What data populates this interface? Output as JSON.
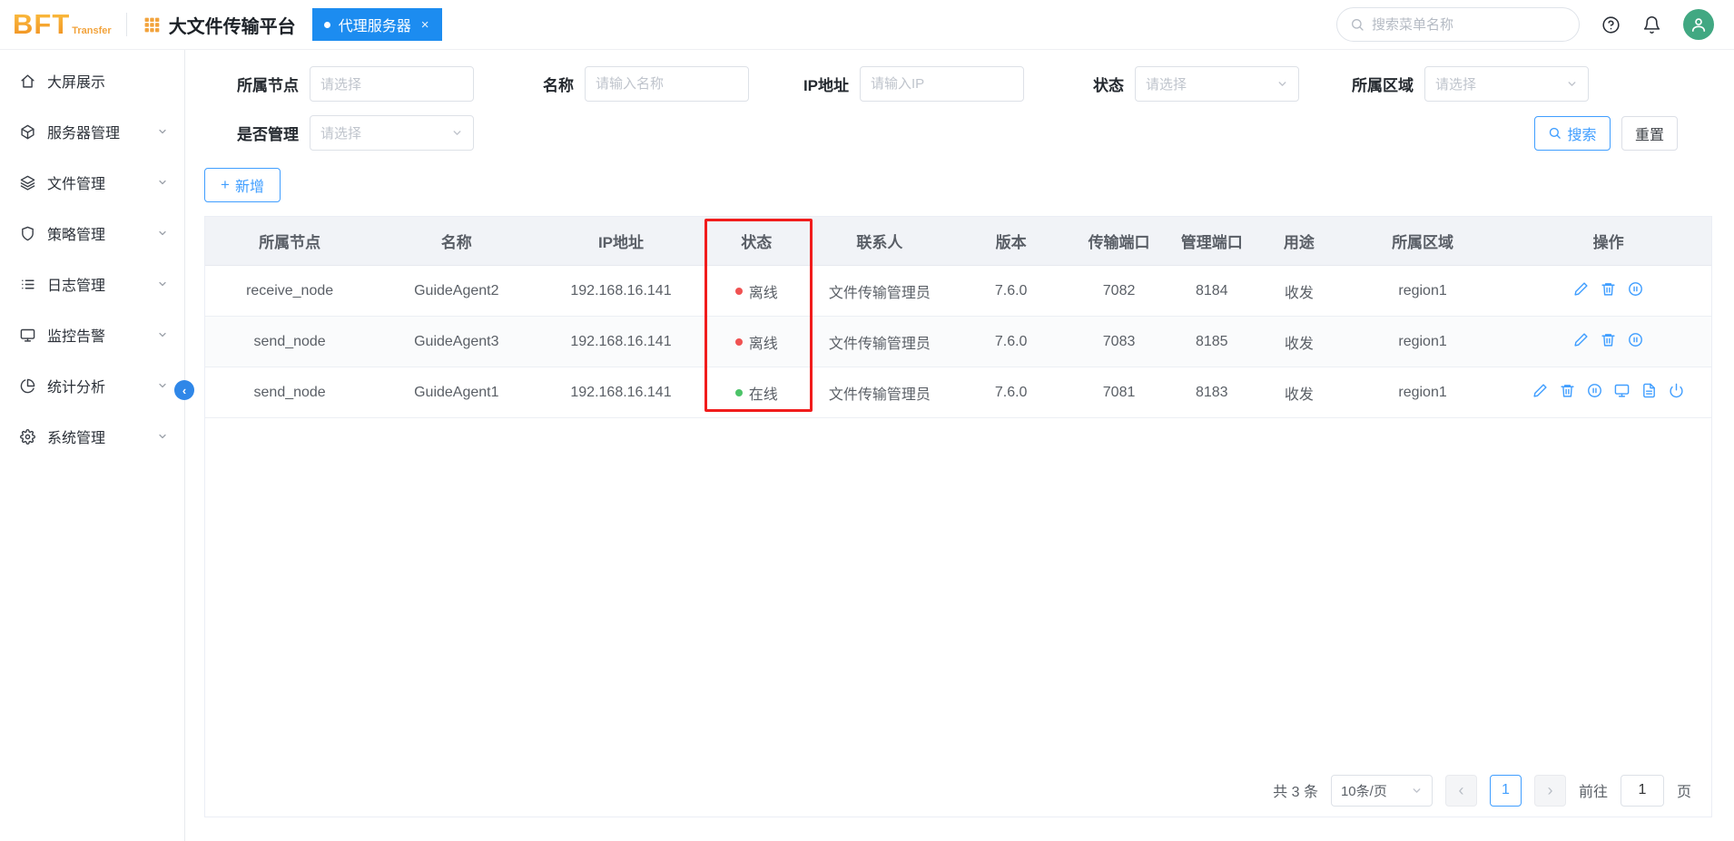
{
  "colors": {
    "accent": "#409eff",
    "tab_blue": "#1c8cf0",
    "logo_orange": "#f2a33c",
    "status_online": "#4cc368",
    "status_offline": "#f05252",
    "annotation_red": "#f11c1c",
    "table_header_bg": "#f1f3f7"
  },
  "header": {
    "logo_main": "BFT",
    "logo_sub": "Transfer",
    "app_title": "大文件传输平台",
    "tab_label": "代理服务器",
    "tab_close": "×",
    "search_placeholder": "搜索菜单名称"
  },
  "sidebar": {
    "items": [
      {
        "label": "大屏展示"
      },
      {
        "label": "服务器管理"
      },
      {
        "label": "文件管理"
      },
      {
        "label": "策略管理"
      },
      {
        "label": "日志管理"
      },
      {
        "label": "监控告警"
      },
      {
        "label": "统计分析"
      },
      {
        "label": "系统管理"
      }
    ]
  },
  "filters": {
    "node_label": "所属节点",
    "node_placeholder": "请选择",
    "name_label": "名称",
    "name_placeholder": "请输入名称",
    "ip_label": "IP地址",
    "ip_placeholder": "请输入IP",
    "status_label": "状态",
    "status_placeholder": "请选择",
    "region_label": "所属区域",
    "region_placeholder": "请选择",
    "managed_label": "是否管理",
    "managed_placeholder": "请选择",
    "search_button": "搜索",
    "reset_button": "重置"
  },
  "toolbar": {
    "add_button": "新增",
    "add_plus": "+"
  },
  "table": {
    "columns": [
      "所属节点",
      "名称",
      "IP地址",
      "状态",
      "联系人",
      "版本",
      "传输端口",
      "管理端口",
      "用途",
      "所属区域",
      "操作"
    ],
    "rows": [
      {
        "node": "receive_node",
        "name": "GuideAgent2",
        "ip": "192.168.16.141",
        "status": "离线",
        "contact": "文件传输管理员",
        "version": "7.6.0",
        "transfer_port": "7082",
        "manage_port": "8184",
        "usage": "收发",
        "region": "region1"
      },
      {
        "node": "send_node",
        "name": "GuideAgent3",
        "ip": "192.168.16.141",
        "status": "离线",
        "contact": "文件传输管理员",
        "version": "7.6.0",
        "transfer_port": "7083",
        "manage_port": "8185",
        "usage": "收发",
        "region": "region1"
      },
      {
        "node": "send_node",
        "name": "GuideAgent1",
        "ip": "192.168.16.141",
        "status": "在线",
        "contact": "文件传输管理员",
        "version": "7.6.0",
        "transfer_port": "7081",
        "manage_port": "8183",
        "usage": "收发",
        "region": "region1"
      }
    ]
  },
  "pagination": {
    "total_text": "共 3 条",
    "page_size_text": "10条/页",
    "prev_arrow": "‹",
    "next_arrow": "›",
    "current_page": "1",
    "goto_label": "前往",
    "goto_value": "1",
    "unit_label": "页"
  }
}
